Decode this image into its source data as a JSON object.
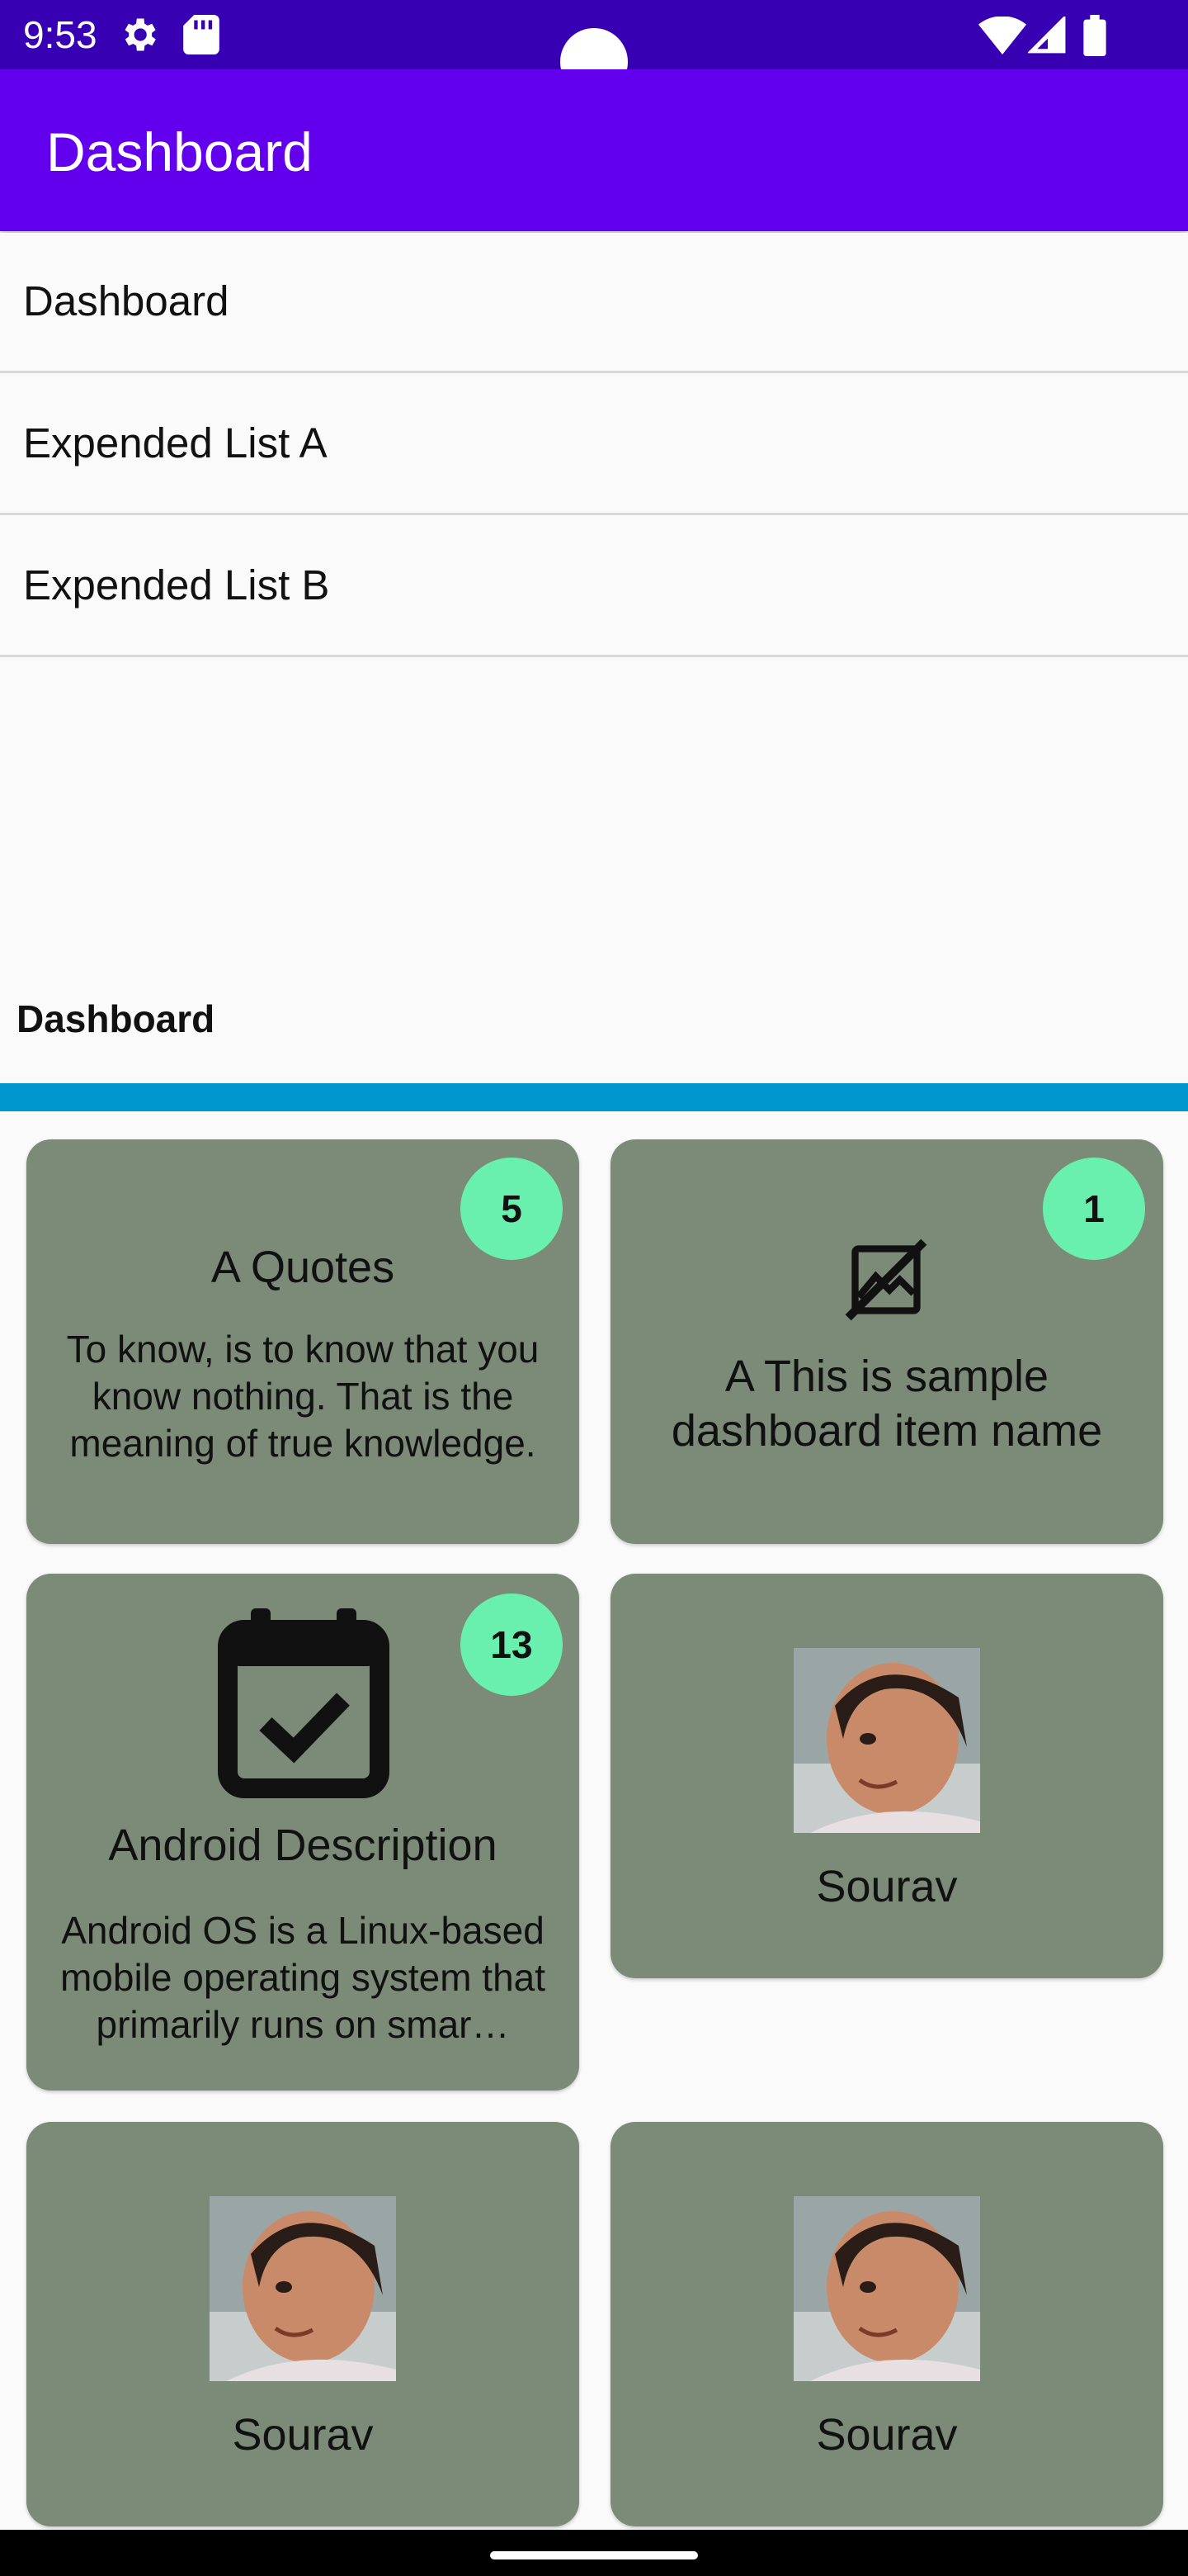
{
  "status_bar": {
    "time": "9:53",
    "left_icons": [
      "settings-gear-icon",
      "sd-card-icon"
    ],
    "right_icons": [
      "wifi-icon",
      "cellular-signal-icon",
      "battery-icon"
    ]
  },
  "app_bar": {
    "title": "Dashboard"
  },
  "menu": {
    "items": [
      {
        "label": "Dashboard"
      },
      {
        "label": "Expended List A"
      },
      {
        "label": "Expended List B"
      }
    ]
  },
  "section": {
    "title": "Dashboard"
  },
  "colors": {
    "status_bar": "#3700b3",
    "app_bar": "#6200ee",
    "divider": "#0097cf",
    "card": "#7b8b77",
    "badge": "#69f0ae"
  },
  "cards": [
    {
      "badge": "5",
      "title": "A Quotes",
      "description": "To know, is to know that you know nothing. That is the meaning of true knowledge."
    },
    {
      "badge": "1",
      "icon": "broken-image-icon",
      "title": "A This is sample dashboard item name"
    },
    {
      "badge": "13",
      "icon": "calendar-check-icon",
      "title": "Android Description",
      "description": "Android OS is a Linux-based mobile operating system that primarily runs on smar…"
    },
    {
      "image": "child-portrait-photo",
      "title": "Sourav"
    },
    {
      "image": "child-portrait-photo",
      "title": "Sourav"
    },
    {
      "image": "child-portrait-photo",
      "title": "Sourav"
    }
  ]
}
